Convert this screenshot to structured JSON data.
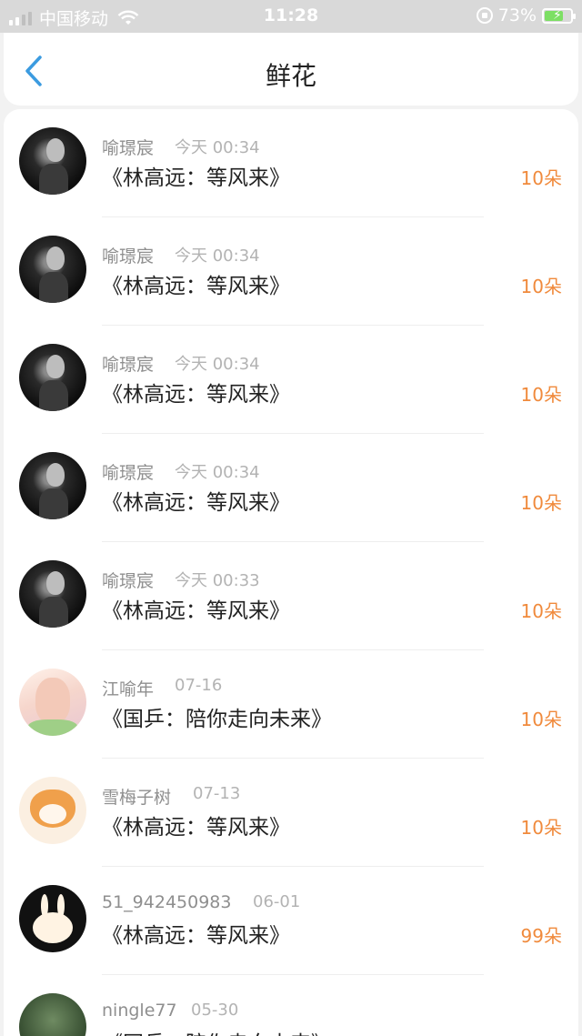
{
  "status_bar": {
    "carrier": "中国移动",
    "time": "11:28",
    "battery_percent": "73%",
    "battery_level": 0.73,
    "icons": [
      "signal-icon",
      "wifi-icon",
      "orientation-lock-icon",
      "battery-icon"
    ]
  },
  "nav": {
    "title": "鲜花",
    "back_icon": "chevron-left-icon",
    "accent_color": "#3b9be0"
  },
  "colors": {
    "amount": "#f08a3c",
    "username": "#8f8f8f",
    "time": "#b3b3b3"
  },
  "items": [
    {
      "user": "喻璟宸",
      "time": "今天 00:34",
      "title": "《林高远：等风来》",
      "amount": "10朵",
      "avatar": "bw-portrait"
    },
    {
      "user": "喻璟宸",
      "time": "今天 00:34",
      "title": "《林高远：等风来》",
      "amount": "10朵",
      "avatar": "bw-portrait"
    },
    {
      "user": "喻璟宸",
      "time": "今天 00:34",
      "title": "《林高远：等风来》",
      "amount": "10朵",
      "avatar": "bw-portrait"
    },
    {
      "user": "喻璟宸",
      "time": "今天 00:34",
      "title": "《林高远：等风来》",
      "amount": "10朵",
      "avatar": "bw-portrait"
    },
    {
      "user": "喻璟宸",
      "time": "今天 00:33",
      "title": "《林高远：等风来》",
      "amount": "10朵",
      "avatar": "bw-portrait"
    },
    {
      "user": "江喻年",
      "time": "07-16",
      "title": "《国乒：陪你走向未来》",
      "amount": "10朵",
      "avatar": "anime-girl"
    },
    {
      "user": "雪梅子树",
      "time": "07-13",
      "title": "《林高远：等风来》",
      "amount": "10朵",
      "avatar": "shiba-dog"
    },
    {
      "user": "51_942450983",
      "time": "06-01",
      "title": "《林高远：等风来》",
      "amount": "99朵",
      "avatar": "bunny"
    },
    {
      "user": "ningle77",
      "time": "05-30",
      "title": "《国乒：陪你走向未来》",
      "amount": "",
      "avatar": "green-photo"
    }
  ]
}
